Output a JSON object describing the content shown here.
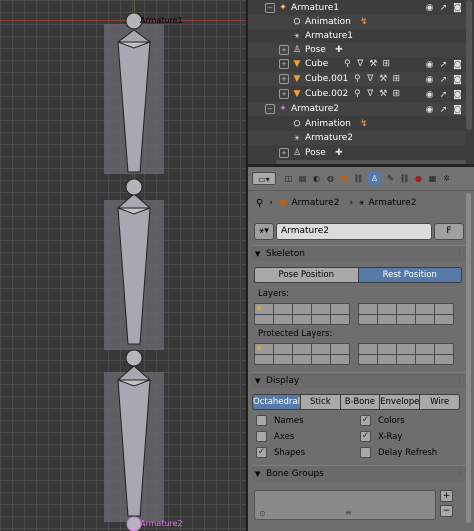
{
  "viewport": {
    "armature_label_top": "Armature1",
    "armature_label_bottom": "Armature2"
  },
  "outliner": {
    "rows": [
      {
        "label": "Armature1",
        "icon": "armature-icon"
      },
      {
        "label": "Animation",
        "icon": "animation-icon"
      },
      {
        "label": "Armature1",
        "icon": "armature-data-icon"
      },
      {
        "label": "Pose",
        "icon": "pose-icon"
      },
      {
        "label": "Cube",
        "icon": "mesh-icon"
      },
      {
        "label": "Cube.001",
        "icon": "mesh-icon"
      },
      {
        "label": "Cube.002",
        "icon": "mesh-icon"
      },
      {
        "label": "Armature2",
        "icon": "armature-icon"
      },
      {
        "label": "Animation",
        "icon": "animation-icon"
      },
      {
        "label": "Armature2",
        "icon": "armature-data-icon"
      },
      {
        "label": "Pose",
        "icon": "pose-icon"
      }
    ]
  },
  "properties": {
    "breadcrumb": [
      "Armature2",
      "Armature2"
    ],
    "datablock_name": "Armature2",
    "fake_user_label": "F",
    "skeleton": {
      "title": "Skeleton",
      "position_buttons": [
        "Pose Position",
        "Rest Position"
      ],
      "active_position": "Rest Position",
      "layers_label": "Layers:",
      "protected_layers_label": "Protected Layers:"
    },
    "display": {
      "title": "Display",
      "modes": [
        "Octahedral",
        "Stick",
        "B-Bone",
        "Envelope",
        "Wire"
      ],
      "active_mode": "Octahedral",
      "options": [
        {
          "label": "Names",
          "checked": false
        },
        {
          "label": "Colors",
          "checked": true
        },
        {
          "label": "Axes",
          "checked": false
        },
        {
          "label": "X-Ray",
          "checked": true
        },
        {
          "label": "Shapes",
          "checked": true
        },
        {
          "label": "Delay Refresh",
          "checked": false
        }
      ]
    },
    "bone_groups": {
      "title": "Bone Groups",
      "add": "+",
      "remove": "−"
    }
  },
  "colors": {
    "accent": "#5779a8",
    "selected_armature": "#e070e0",
    "bone_fill": "#9a9aa6"
  }
}
